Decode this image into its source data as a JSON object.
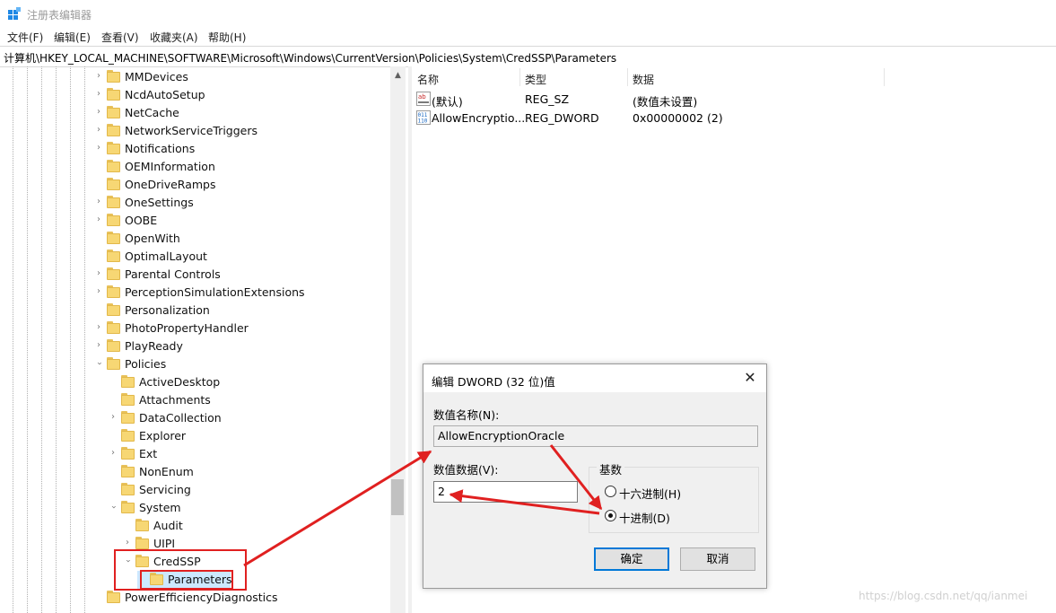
{
  "window": {
    "title": "注册表编辑器"
  },
  "menu": [
    "文件(F)",
    "编辑(E)",
    "查看(V)",
    "收藏夹(A)",
    "帮助(H)"
  ],
  "address": "计算机\\HKEY_LOCAL_MACHINE\\SOFTWARE\\Microsoft\\Windows\\CurrentVersion\\Policies\\System\\CredSSP\\Parameters",
  "tree": {
    "level1": [
      "MMDevices",
      "NcdAutoSetup",
      "NetCache",
      "NetworkServiceTriggers",
      "Notifications",
      "OEMInformation",
      "OneDriveRamps",
      "OneSettings",
      "OOBE",
      "OpenWith",
      "OptimalLayout",
      "Parental Controls",
      "PerceptionSimulationExtensions",
      "Personalization",
      "PhotoPropertyHandler",
      "PlayReady",
      "Policies"
    ],
    "policies_children": [
      "ActiveDesktop",
      "Attachments",
      "DataCollection",
      "Explorer",
      "Ext",
      "NonEnum",
      "Servicing",
      "System"
    ],
    "system_children": [
      "Audit",
      "UIPI",
      "CredSSP"
    ],
    "credssp_children": [
      "Parameters"
    ],
    "after": [
      "PowerEfficiencyDiagnostics"
    ]
  },
  "list": {
    "headers": {
      "name": "名称",
      "type": "类型",
      "data": "数据"
    },
    "rows": [
      {
        "name": "(默认)",
        "type": "REG_SZ",
        "data": "(数值未设置)",
        "icon": "string-value-icon"
      },
      {
        "name": "AllowEncryptio...",
        "type": "REG_DWORD",
        "data": "0x00000002 (2)",
        "icon": "binary-value-icon"
      }
    ]
  },
  "dialog": {
    "title": "编辑 DWORD (32 位)值",
    "name_label": "数值名称(N):",
    "name_value": "AllowEncryptionOracle",
    "data_label": "数值数据(V):",
    "data_value": "2",
    "base_label": "基数",
    "hex_label": "十六进制(H)",
    "dec_label": "十进制(D)",
    "base_selected": "dec",
    "ok_label": "确定",
    "cancel_label": "取消"
  },
  "annotation": {
    "color": "#e02020"
  },
  "watermark": "https://blog.csdn.net/qq/ianmei"
}
